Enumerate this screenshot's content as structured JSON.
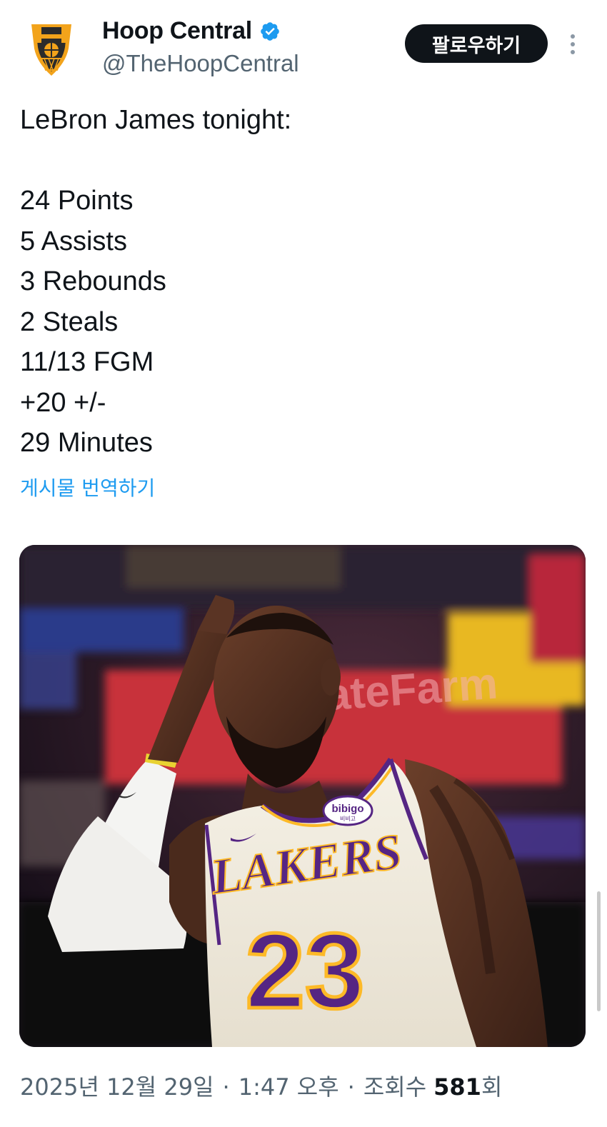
{
  "author": {
    "display_name": "Hoop Central",
    "handle": "@TheHoopCentral",
    "verified": true,
    "avatar_icon": "hoop-central-logo-icon"
  },
  "actions": {
    "follow_label": "팔로우하기",
    "more_icon": "more-vertical-icon"
  },
  "tweet": {
    "lines": [
      "LeBron James tonight:",
      "",
      "24 Points",
      "5 Assists",
      "3 Rebounds",
      "2 Steals",
      "11/13 FGM",
      "+20 +/-",
      "29 Minutes"
    ],
    "translate_label": "게시물 번역하기"
  },
  "media": {
    "jersey_team": "LAKERS",
    "jersey_number": "23",
    "sponsor_patch": "bibigo",
    "sponsor_patch_small": "비비고",
    "arena_banner": "StateFarm"
  },
  "meta": {
    "date": "2025년 12월 29일",
    "separator": "·",
    "time": "1:47 오후",
    "views_label": "조회수",
    "views_count": "581",
    "views_suffix": "회"
  },
  "colors": {
    "follow_bg": "#0f1419",
    "link": "#1d9bf0",
    "verified": "#1d9bf0",
    "secondary_text": "#536471",
    "lakers_purple": "#552583",
    "lakers_gold": "#fdb927"
  }
}
